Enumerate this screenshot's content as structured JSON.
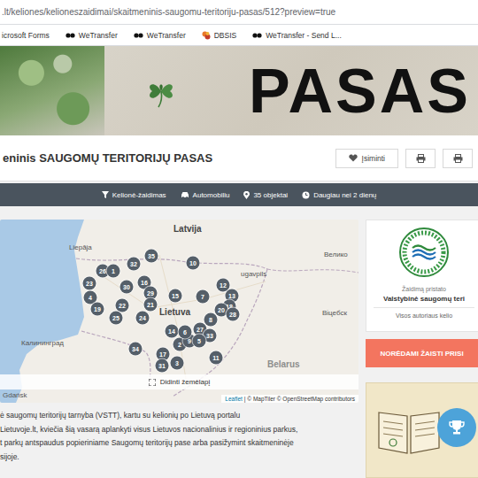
{
  "browser": {
    "url": ".lt/keliones/kelioneszaidimai/skaitmeninis-saugomu-teritoriju-pasas/512?preview=true",
    "bookmarks": [
      {
        "label": "icrosoft Forms",
        "kind": "plain"
      },
      {
        "label": "WeTransfer",
        "kind": "we"
      },
      {
        "label": "WeTransfer",
        "kind": "we"
      },
      {
        "label": "DBSIS",
        "kind": "db"
      },
      {
        "label": "WeTransfer - Send L...",
        "kind": "we"
      }
    ]
  },
  "banner": {
    "title": "PASAS"
  },
  "header": {
    "title": "eninis SAUGOMŲ TERITORIJŲ PASAS",
    "save_label": "Įsiminti"
  },
  "info_bar": [
    {
      "label": "Kelionė-žaidimas"
    },
    {
      "label": "Automobiliu"
    },
    {
      "label": "35 objektai"
    },
    {
      "label": "Daugiau nei 2 dienų"
    }
  ],
  "map": {
    "labels": [
      {
        "text": "Latvija",
        "kind": "country"
      },
      {
        "text": "Liepāja",
        "kind": "city"
      },
      {
        "text": "Lietuva",
        "kind": "country"
      },
      {
        "text": "ugavpils",
        "kind": "city"
      },
      {
        "text": "Велико",
        "kind": "city"
      },
      {
        "text": "Віцебск",
        "kind": "city"
      },
      {
        "text": "Калининград",
        "kind": "city"
      },
      {
        "text": "Gdańsk",
        "kind": "city"
      },
      {
        "text": "Belarus",
        "kind": "faded"
      }
    ],
    "markers": [
      "26",
      "1",
      "32",
      "35",
      "10",
      "23",
      "30",
      "16",
      "12",
      "29",
      "7",
      "13",
      "4",
      "22",
      "21",
      "15",
      "18",
      "19",
      "25",
      "24",
      "20",
      "28",
      "8",
      "14",
      "27",
      "33",
      "2",
      "9",
      "5",
      "34",
      "17",
      "11",
      "31",
      "3",
      "6"
    ],
    "enlarge_label": "Didinti žemėlapį",
    "attribution": {
      "link": "Leaflet",
      "credits": "| © MapTiler © OpenStreetMap contributors"
    }
  },
  "sidebar": {
    "presented_by": "Žaidimą pristato",
    "author": "Valstybinė saugomų teri",
    "all_trips": "Visos autoriaus kelio",
    "play_button": "NORĖDAMI ŽAISTI PRISI"
  },
  "description": [
    "ė saugomų teritorijų tarnyba (VSTT), kartu su kelionių po Lietuvą portalu",
    "Lietuvoje.lt, kviečia šią vasarą aplankyti visus Lietuvos nacionalinius ir regioninius parkus,",
    "t parkų antspaudus popieriniame Saugomų teritorijų pase arba pasižymint skaitmeninėje",
    "sijoje."
  ]
}
